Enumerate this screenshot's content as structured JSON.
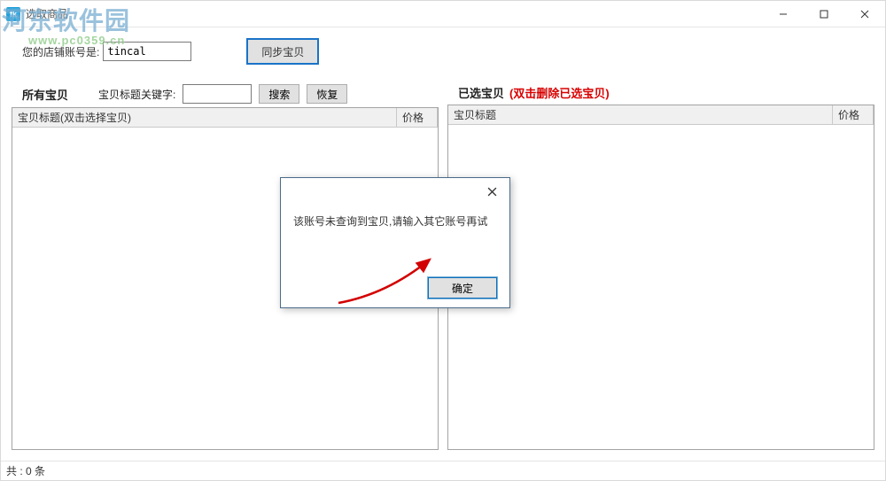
{
  "window": {
    "title": "选取商品"
  },
  "top": {
    "shop_label": "您的店铺账号是:",
    "shop_value": "tincal",
    "sync_btn": "同步宝贝"
  },
  "left": {
    "title": "所有宝贝",
    "kw_label": "宝贝标题关键字:",
    "kw_value": "",
    "search_btn": "搜索",
    "restore_btn": "恢复",
    "col_title": "宝贝标题(双击选择宝贝)",
    "col_price": "价格"
  },
  "right": {
    "title": "已选宝贝",
    "hint": "(双击删除已选宝贝)",
    "col_title": "宝贝标题",
    "col_price": "价格"
  },
  "modal": {
    "message": "该账号未查询到宝贝,请输入其它账号再试",
    "ok": "确定"
  },
  "status": {
    "prefix": "共 :",
    "count": "0",
    "suffix": "条"
  },
  "watermark": {
    "name": "河东软件园",
    "url": "www.pc0359.cn"
  }
}
